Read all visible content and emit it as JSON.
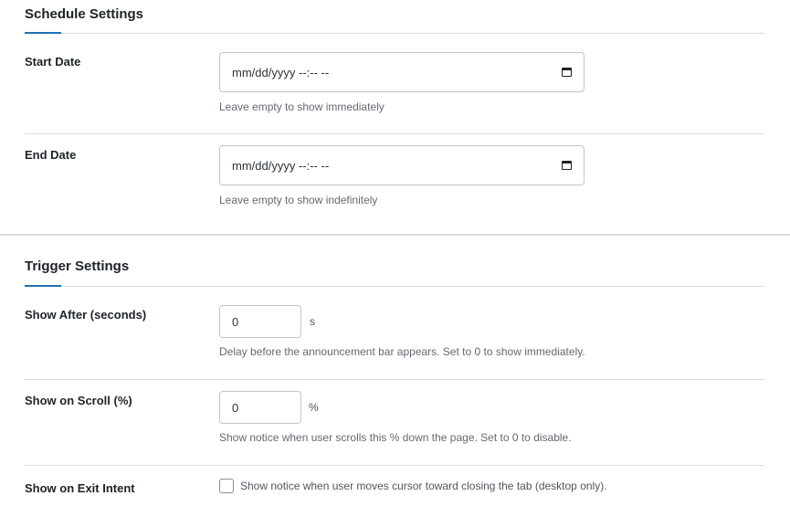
{
  "schedule": {
    "title": "Schedule Settings",
    "start": {
      "label": "Start Date",
      "placeholder": "mm/dd/yyyy --:-- --",
      "help": "Leave empty to show immediately"
    },
    "end": {
      "label": "End Date",
      "placeholder": "mm/dd/yyyy --:-- --",
      "help": "Leave empty to show indefinitely"
    }
  },
  "trigger": {
    "title": "Trigger Settings",
    "after": {
      "label": "Show After (seconds)",
      "value": "0",
      "unit": "s",
      "help": "Delay before the announcement bar appears. Set to 0 to show immediately."
    },
    "scroll": {
      "label": "Show on Scroll (%)",
      "value": "0",
      "unit": "%",
      "help": "Show notice when user scrolls this % down the page. Set to 0 to disable."
    },
    "exit": {
      "label": "Show on Exit Intent",
      "checked": false,
      "text": "Show notice when user moves cursor toward closing the tab (desktop only)."
    }
  }
}
